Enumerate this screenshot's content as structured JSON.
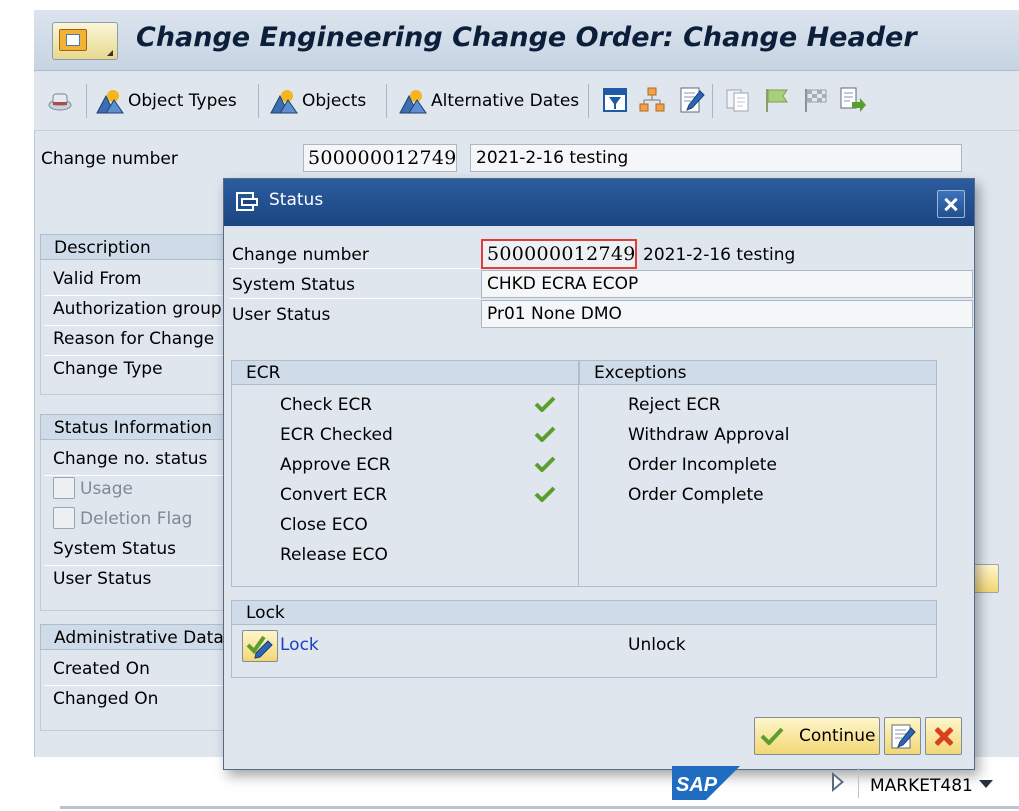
{
  "window": {
    "title": "Change Engineering Change Order: Change Header"
  },
  "toolbar": {
    "object_types": "Object Types",
    "objects": "Objects",
    "alternative_dates": "Alternative Dates"
  },
  "header": {
    "change_number_label": "Change number",
    "change_number": "500000012749",
    "description": "2021-2-16 testing"
  },
  "groups": {
    "description": {
      "title": "Description",
      "rows": [
        "Valid From",
        "Authorization group",
        "Reason for Change",
        "Change Type"
      ]
    },
    "status_information": {
      "title": "Status Information",
      "change_no_status": "Change no. status",
      "usage": "Usage",
      "deletion_flag": "Deletion Flag",
      "system_status": "System Status",
      "user_status": "User Status"
    },
    "administrative_data": {
      "title": "Administrative Data",
      "rows": [
        "Created On",
        "Changed On"
      ]
    }
  },
  "dialog": {
    "title": "Status",
    "change_number_label": "Change number",
    "change_number": "500000012749",
    "change_description": "2021-2-16 testing",
    "system_status_label": "System Status",
    "system_status": "CHKD ECRA ECOP",
    "user_status_label": "User Status",
    "user_status": "Pr01 None DMO",
    "ecr": {
      "title": "ECR",
      "items": [
        {
          "label": "Check ECR",
          "checked": true
        },
        {
          "label": "ECR Checked",
          "checked": true
        },
        {
          "label": "Approve ECR",
          "checked": true
        },
        {
          "label": "Convert ECR",
          "checked": true
        },
        {
          "label": "Close ECO",
          "checked": false
        },
        {
          "label": "Release ECO",
          "checked": false
        }
      ]
    },
    "exceptions": {
      "title": "Exceptions",
      "items": [
        "Reject ECR",
        "Withdraw Approval",
        "Order Incomplete",
        "Order Complete"
      ]
    },
    "lock": {
      "title": "Lock",
      "lock_label": "Lock",
      "unlock_label": "Unlock"
    },
    "buttons": {
      "continue": "Continue"
    }
  },
  "footer": {
    "logo": "SAP",
    "system": "MARKET481"
  },
  "colors": {
    "dialog_title_bg": "#1b4682",
    "panel_bg": "#dfe6ee",
    "check_green": "#5c9e2e",
    "link_blue": "#1a3ec7"
  }
}
